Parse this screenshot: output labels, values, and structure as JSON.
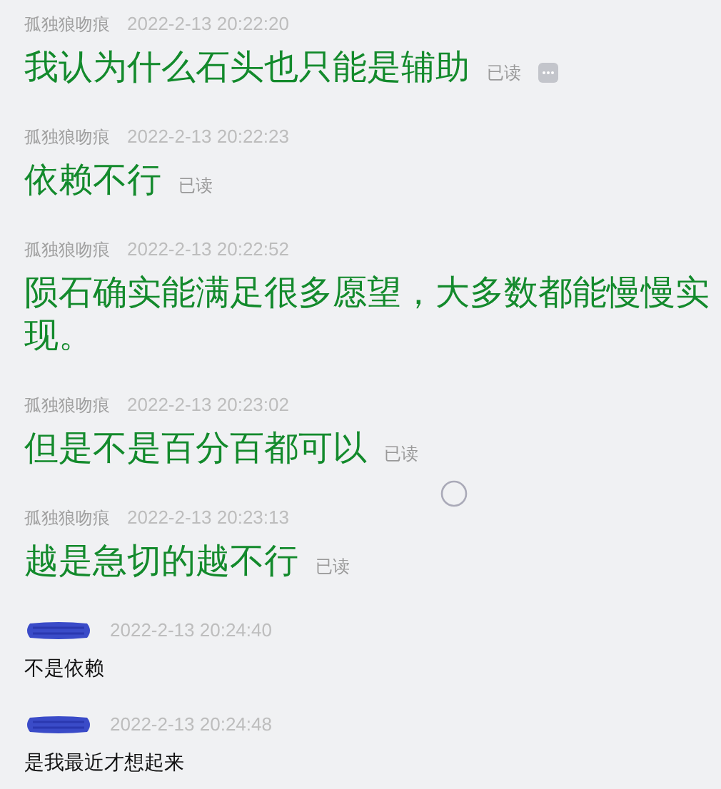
{
  "messages": [
    {
      "kind": "large",
      "sender": {
        "name": "孤独狼吻痕"
      },
      "time": "2022-2-13 20:22:20",
      "text": "我认为什么石头也只能是辅助",
      "read_label": "已读",
      "more_button": true
    },
    {
      "kind": "large",
      "sender": {
        "name": "孤独狼吻痕"
      },
      "time": "2022-2-13 20:22:23",
      "text": "依赖不行",
      "read_label": "已读"
    },
    {
      "kind": "large",
      "sender": {
        "name": "孤独狼吻痕"
      },
      "time": "2022-2-13 20:22:52",
      "text": "陨石确实能满足很多愿望，大多数都能慢慢实现。"
    },
    {
      "kind": "large",
      "sender": {
        "name": "孤独狼吻痕"
      },
      "time": "2022-2-13 20:23:02",
      "text": "但是不是百分百都可以",
      "read_label": "已读"
    },
    {
      "kind": "large",
      "sender": {
        "name": "孤独狼吻痕"
      },
      "time": "2022-2-13 20:23:13",
      "text": "越是急切的越不行",
      "read_label": "已读"
    },
    {
      "kind": "small",
      "sender": {
        "redacted": true
      },
      "time": "2022-2-13 20:24:40",
      "text": "不是依赖"
    },
    {
      "kind": "small",
      "sender": {
        "redacted": true
      },
      "time": "2022-2-13 20:24:48",
      "text": "是我最近才想起来"
    }
  ]
}
